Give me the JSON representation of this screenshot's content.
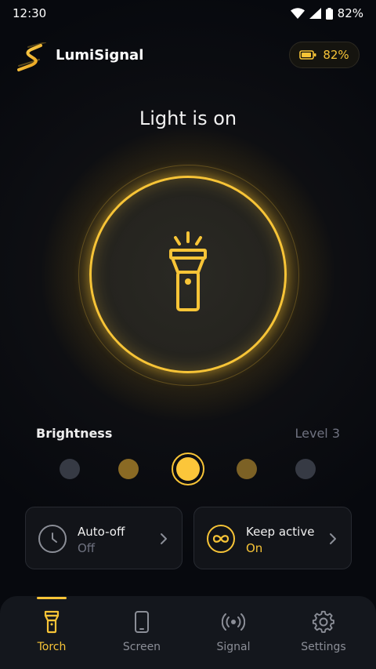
{
  "status_bar": {
    "time": "12:30",
    "battery_percent": "82%"
  },
  "header": {
    "app_title": "LumiSignal",
    "battery_chip": "82%"
  },
  "torch": {
    "status_text": "Light is on",
    "is_on": true
  },
  "brightness": {
    "label": "Brightness",
    "level_text": "Level 3",
    "selected_level": 3,
    "levels": 5
  },
  "cards": {
    "auto_off": {
      "title": "Auto-off",
      "value": "Off"
    },
    "keep_active": {
      "title": "Keep active",
      "value": "On"
    }
  },
  "nav": {
    "items": [
      {
        "label": "Torch",
        "icon": "flashlight-icon",
        "active": true
      },
      {
        "label": "Screen",
        "icon": "phone-icon",
        "active": false
      },
      {
        "label": "Signal",
        "icon": "broadcast-icon",
        "active": false
      },
      {
        "label": "Settings",
        "icon": "gear-icon",
        "active": false
      }
    ]
  },
  "colors": {
    "accent": "#f7c437",
    "background": "#07090e",
    "muted": "#6f7280",
    "card": "#121419"
  }
}
